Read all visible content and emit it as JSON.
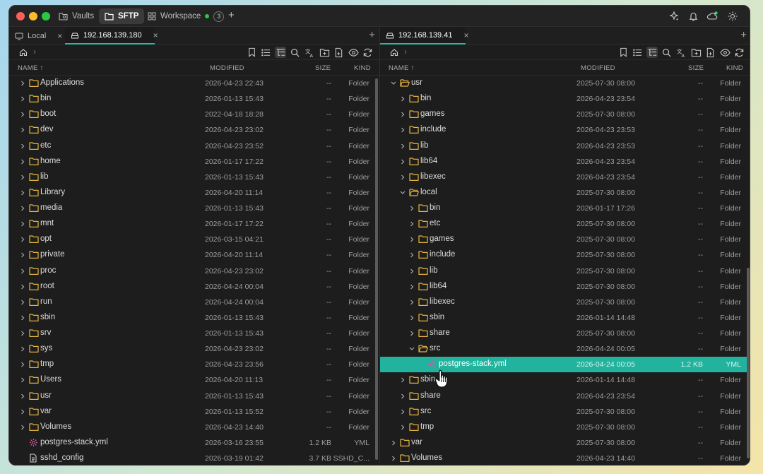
{
  "app": {
    "tabs": [
      {
        "label": "Vaults",
        "icon": "vault-folder-icon"
      },
      {
        "label": "SFTP",
        "icon": "folder-icon"
      },
      {
        "label": "Workspace",
        "icon": "grid-icon",
        "count": "3"
      }
    ]
  },
  "left": {
    "tabs": [
      {
        "label": "Local"
      },
      {
        "label": "192.168.139.180"
      }
    ],
    "columns": {
      "name": "NAME ↑",
      "modified": "MODIFIED",
      "size": "SIZE",
      "kind": "KIND"
    },
    "rows": [
      {
        "name": "Applications",
        "modified": "2026-04-23 22:43",
        "size": "--",
        "kind": "Folder",
        "type": "folder",
        "depth": 0
      },
      {
        "name": "bin",
        "modified": "2026-01-13 15:43",
        "size": "--",
        "kind": "Folder",
        "type": "folder",
        "depth": 0
      },
      {
        "name": "boot",
        "modified": "2022-04-18 18:28",
        "size": "--",
        "kind": "Folder",
        "type": "folder",
        "depth": 0
      },
      {
        "name": "dev",
        "modified": "2026-04-23 23:02",
        "size": "--",
        "kind": "Folder",
        "type": "folder",
        "depth": 0
      },
      {
        "name": "etc",
        "modified": "2026-04-23 23:52",
        "size": "--",
        "kind": "Folder",
        "type": "folder",
        "depth": 0
      },
      {
        "name": "home",
        "modified": "2026-01-17 17:22",
        "size": "--",
        "kind": "Folder",
        "type": "folder",
        "depth": 0
      },
      {
        "name": "lib",
        "modified": "2026-01-13 15:43",
        "size": "--",
        "kind": "Folder",
        "type": "folder",
        "depth": 0
      },
      {
        "name": "Library",
        "modified": "2026-04-20 11:14",
        "size": "--",
        "kind": "Folder",
        "type": "folder",
        "depth": 0
      },
      {
        "name": "media",
        "modified": "2026-01-13 15:43",
        "size": "--",
        "kind": "Folder",
        "type": "folder",
        "depth": 0
      },
      {
        "name": "mnt",
        "modified": "2026-01-17 17:22",
        "size": "--",
        "kind": "Folder",
        "type": "folder",
        "depth": 0
      },
      {
        "name": "opt",
        "modified": "2026-03-15 04:21",
        "size": "--",
        "kind": "Folder",
        "type": "folder",
        "depth": 0
      },
      {
        "name": "private",
        "modified": "2026-04-20 11:14",
        "size": "--",
        "kind": "Folder",
        "type": "folder",
        "depth": 0
      },
      {
        "name": "proc",
        "modified": "2026-04-23 23:02",
        "size": "--",
        "kind": "Folder",
        "type": "folder",
        "depth": 0
      },
      {
        "name": "root",
        "modified": "2026-04-24 00:04",
        "size": "--",
        "kind": "Folder",
        "type": "folder",
        "depth": 0
      },
      {
        "name": "run",
        "modified": "2026-04-24 00:04",
        "size": "--",
        "kind": "Folder",
        "type": "folder",
        "depth": 0
      },
      {
        "name": "sbin",
        "modified": "2026-01-13 15:43",
        "size": "--",
        "kind": "Folder",
        "type": "folder",
        "depth": 0
      },
      {
        "name": "srv",
        "modified": "2026-01-13 15:43",
        "size": "--",
        "kind": "Folder",
        "type": "folder",
        "depth": 0
      },
      {
        "name": "sys",
        "modified": "2026-04-23 23:02",
        "size": "--",
        "kind": "Folder",
        "type": "folder",
        "depth": 0
      },
      {
        "name": "tmp",
        "modified": "2026-04-23 23:56",
        "size": "--",
        "kind": "Folder",
        "type": "folder",
        "depth": 0
      },
      {
        "name": "Users",
        "modified": "2026-04-20 11:13",
        "size": "--",
        "kind": "Folder",
        "type": "folder",
        "depth": 0
      },
      {
        "name": "usr",
        "modified": "2026-01-13 15:43",
        "size": "--",
        "kind": "Folder",
        "type": "folder",
        "depth": 0
      },
      {
        "name": "var",
        "modified": "2026-01-13 15:52",
        "size": "--",
        "kind": "Folder",
        "type": "folder",
        "depth": 0
      },
      {
        "name": "Volumes",
        "modified": "2026-04-23 14:40",
        "size": "--",
        "kind": "Folder",
        "type": "folder",
        "depth": 0
      },
      {
        "name": "postgres-stack.yml",
        "modified": "2026-03-16 23:55",
        "size": "1.2 KB",
        "kind": "YML",
        "type": "yml",
        "depth": 0
      },
      {
        "name": "sshd_config",
        "modified": "2026-03-19 01:42",
        "size": "3.7 KB",
        "kind": "SSHD_C...",
        "type": "file",
        "depth": 0
      }
    ]
  },
  "right": {
    "tabs": [
      {
        "label": "192.168.139.41"
      }
    ],
    "columns": {
      "name": "NAME ↑",
      "modified": "MODIFIED",
      "size": "SIZE",
      "kind": "KIND"
    },
    "rows": [
      {
        "name": "usr",
        "modified": "2025-07-30 08:00",
        "size": "--",
        "kind": "Folder",
        "type": "folder-open",
        "depth": 0,
        "expanded": true
      },
      {
        "name": "bin",
        "modified": "2026-04-23 23:54",
        "size": "--",
        "kind": "Folder",
        "type": "folder",
        "depth": 1
      },
      {
        "name": "games",
        "modified": "2025-07-30 08:00",
        "size": "--",
        "kind": "Folder",
        "type": "folder",
        "depth": 1
      },
      {
        "name": "include",
        "modified": "2026-04-23 23:53",
        "size": "--",
        "kind": "Folder",
        "type": "folder",
        "depth": 1
      },
      {
        "name": "lib",
        "modified": "2026-04-23 23:53",
        "size": "--",
        "kind": "Folder",
        "type": "folder",
        "depth": 1
      },
      {
        "name": "lib64",
        "modified": "2026-04-23 23:54",
        "size": "--",
        "kind": "Folder",
        "type": "folder",
        "depth": 1
      },
      {
        "name": "libexec",
        "modified": "2026-04-23 23:54",
        "size": "--",
        "kind": "Folder",
        "type": "folder",
        "depth": 1
      },
      {
        "name": "local",
        "modified": "2025-07-30 08:00",
        "size": "--",
        "kind": "Folder",
        "type": "folder-open",
        "depth": 1,
        "expanded": true
      },
      {
        "name": "bin",
        "modified": "2026-01-17 17:26",
        "size": "--",
        "kind": "Folder",
        "type": "folder",
        "depth": 2
      },
      {
        "name": "etc",
        "modified": "2025-07-30 08:00",
        "size": "--",
        "kind": "Folder",
        "type": "folder",
        "depth": 2
      },
      {
        "name": "games",
        "modified": "2025-07-30 08:00",
        "size": "--",
        "kind": "Folder",
        "type": "folder",
        "depth": 2
      },
      {
        "name": "include",
        "modified": "2025-07-30 08:00",
        "size": "--",
        "kind": "Folder",
        "type": "folder",
        "depth": 2
      },
      {
        "name": "lib",
        "modified": "2025-07-30 08:00",
        "size": "--",
        "kind": "Folder",
        "type": "folder",
        "depth": 2
      },
      {
        "name": "lib64",
        "modified": "2025-07-30 08:00",
        "size": "--",
        "kind": "Folder",
        "type": "folder",
        "depth": 2
      },
      {
        "name": "libexec",
        "modified": "2025-07-30 08:00",
        "size": "--",
        "kind": "Folder",
        "type": "folder",
        "depth": 2
      },
      {
        "name": "sbin",
        "modified": "2026-01-14 14:48",
        "size": "--",
        "kind": "Folder",
        "type": "folder",
        "depth": 2
      },
      {
        "name": "share",
        "modified": "2025-07-30 08:00",
        "size": "--",
        "kind": "Folder",
        "type": "folder",
        "depth": 2
      },
      {
        "name": "src",
        "modified": "2026-04-24 00:05",
        "size": "--",
        "kind": "Folder",
        "type": "folder-open",
        "depth": 2,
        "expanded": true
      },
      {
        "name": "postgres-stack.yml",
        "modified": "2026-04-24 00:05",
        "size": "1.2 KB",
        "kind": "YML",
        "type": "yml",
        "depth": 3,
        "selected": true
      },
      {
        "name": "sbin",
        "modified": "2026-01-14 14:48",
        "size": "--",
        "kind": "Folder",
        "type": "folder",
        "depth": 1
      },
      {
        "name": "share",
        "modified": "2026-04-23 23:54",
        "size": "--",
        "kind": "Folder",
        "type": "folder",
        "depth": 1
      },
      {
        "name": "src",
        "modified": "2025-07-30 08:00",
        "size": "--",
        "kind": "Folder",
        "type": "folder",
        "depth": 1
      },
      {
        "name": "tmp",
        "modified": "2025-07-30 08:00",
        "size": "--",
        "kind": "Folder",
        "type": "folder",
        "depth": 1
      },
      {
        "name": "var",
        "modified": "2025-07-30 08:00",
        "size": "--",
        "kind": "Folder",
        "type": "folder",
        "depth": 0
      },
      {
        "name": "Volumes",
        "modified": "2026-04-23 14:40",
        "size": "--",
        "kind": "Folder",
        "type": "folder",
        "depth": 0
      }
    ]
  },
  "colors": {
    "accent": "#21b39e",
    "folder": "#e6b43c",
    "yml": "#d9569f"
  }
}
